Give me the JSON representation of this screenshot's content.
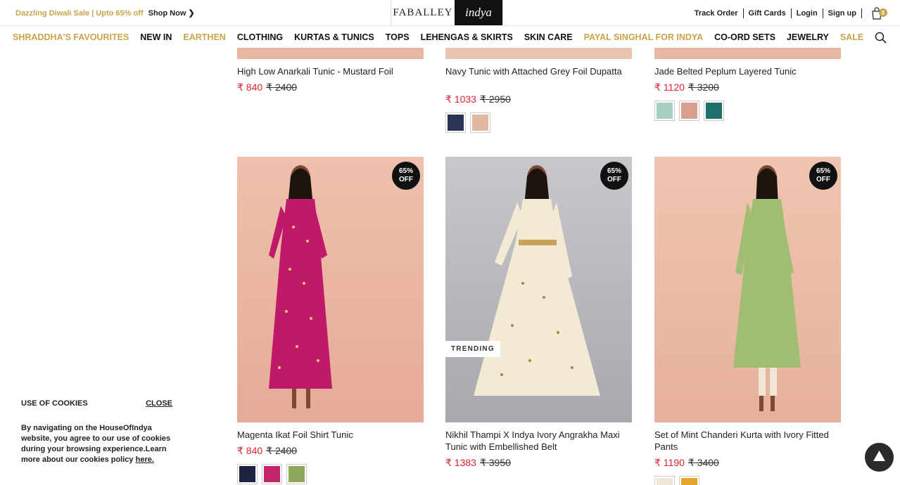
{
  "promo": {
    "sale": "Dazzling Diwali Sale | Upto 65% off",
    "shop": "Shop Now"
  },
  "brand": {
    "left": "FABALLEY",
    "right": "indya"
  },
  "top_links": [
    "Track Order",
    "Gift Cards",
    "Login",
    "Sign up"
  ],
  "cart_count": "0",
  "nav": [
    {
      "label": "SHRADDHA'S FAVOURITES",
      "gold": true
    },
    {
      "label": "NEW IN",
      "gold": false
    },
    {
      "label": "EARTHEN",
      "gold": true
    },
    {
      "label": "CLOTHING",
      "gold": false
    },
    {
      "label": "KURTAS & TUNICS",
      "gold": false
    },
    {
      "label": "TOPS",
      "gold": false
    },
    {
      "label": "LEHENGAS & SKIRTS",
      "gold": false
    },
    {
      "label": "SKIN CARE",
      "gold": false
    },
    {
      "label": "PAYAL SINGHAL FOR INDYA",
      "gold": true
    },
    {
      "label": "CO-ORD SETS",
      "gold": false
    },
    {
      "label": "JEWELRY",
      "gold": false
    },
    {
      "label": "SALE",
      "gold": true
    }
  ],
  "products": [
    {
      "name": "High Low Anarkali Tunic - Mustard Foil",
      "price": "₹ 840",
      "mrp": "₹ 2400",
      "swatches": []
    },
    {
      "name": "Navy Tunic with Attached Grey Foil Dupatta",
      "price": "₹ 1033",
      "mrp": "₹ 2950",
      "swatches": [
        "#2b3455",
        "#e2b8a0"
      ]
    },
    {
      "name": "Jade Belted Peplum Layered Tunic",
      "price": "₹ 1120",
      "mrp": "₹ 3200",
      "swatches": [
        "#a9cfc2",
        "#d9a08e",
        "#1f6f6a"
      ]
    },
    {
      "name": "Magenta Ikat Foil Shirt Tunic",
      "price": "₹ 840",
      "mrp": "₹ 2400",
      "swatches": [
        "#1d2340",
        "#c2236b",
        "#8ea75a"
      ],
      "badge": "65%\nOFF"
    },
    {
      "name": "Nikhil Thampi X Indya Ivory Angrakha Maxi Tunic with Embellished Belt",
      "price": "₹ 1383",
      "mrp": "₹ 3950",
      "swatches": [],
      "badge": "65%\nOFF",
      "tag": "TRENDING"
    },
    {
      "name": "Set of Mint Chanderi Kurta with Ivory Fitted Pants",
      "price": "₹ 1190",
      "mrp": "₹ 3400",
      "swatches": [
        "#efe6d6",
        "#e3a52a"
      ],
      "badge": "65%\nOFF"
    }
  ],
  "badge_text": {
    "l1": "65%",
    "l2": "OFF"
  },
  "cookie": {
    "title": "USE OF COOKIES",
    "close": "CLOSE",
    "body": "By navigating on the HouseOfIndya website, you agree to our use of cookies during your browsing experience.Learn more about our cookies policy",
    "link": "here."
  },
  "colors": {
    "gold": "#c8a44b",
    "price_red": "#e0242e"
  }
}
